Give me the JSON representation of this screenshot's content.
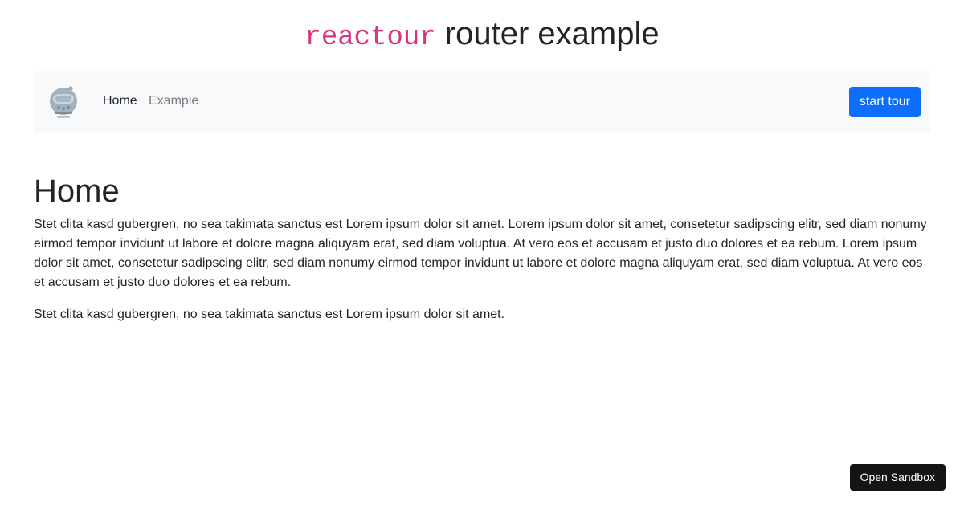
{
  "header": {
    "code_text": "reactour",
    "title_text": "router example"
  },
  "navbar": {
    "logo_icon": "astronaut-helmet-logo-icon",
    "links": [
      {
        "label": "Home",
        "active": true
      },
      {
        "label": "Example",
        "active": false
      }
    ],
    "start_tour_label": "start tour"
  },
  "main": {
    "heading": "Home",
    "paragraphs": [
      "Stet clita kasd gubergren, no sea takimata sanctus est Lorem ipsum dolor sit amet. Lorem ipsum dolor sit amet, consetetur sadipscing elitr, sed diam nonumy eirmod tempor invidunt ut labore et dolore magna aliquyam erat, sed diam voluptua. At vero eos et accusam et justo duo dolores et ea rebum. Lorem ipsum dolor sit amet, consetetur sadipscing elitr, sed diam nonumy eirmod tempor invidunt ut labore et dolore magna aliquyam erat, sed diam voluptua. At vero eos et accusam et justo duo dolores et ea rebum.",
      "Stet clita kasd gubergren, no sea takimata sanctus est Lorem ipsum dolor sit amet."
    ]
  },
  "sandbox": {
    "label": "Open Sandbox"
  },
  "colors": {
    "primary": "#0d6efd",
    "code": "#d63384",
    "navbar_bg": "#f8f9fa",
    "sandbox_bg": "#151515"
  }
}
